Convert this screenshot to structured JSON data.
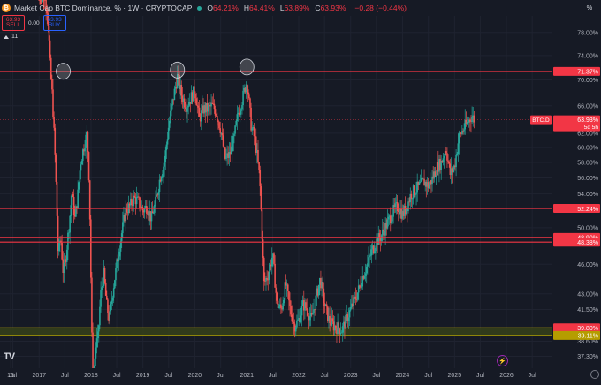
{
  "header": {
    "title": "Market Cap BTC Dominance, % · 1W · CRYPTOCAP",
    "logo_glyph": "₿",
    "ohlc": [
      {
        "key": "O",
        "value": "64.21%"
      },
      {
        "key": "H",
        "value": "64.41%"
      },
      {
        "key": "L",
        "value": "63.89%"
      },
      {
        "key": "C",
        "value": "63.93%"
      }
    ],
    "change": "−0.28 (−0.44%)",
    "sell_price": "63.93",
    "sell_label": "SELL",
    "spread": "0.00",
    "buy_price": "63.93",
    "buy_label": "BUY",
    "indicators_count": "11",
    "scale_button": "%"
  },
  "footer": {
    "tv_logo": "TV",
    "bolt_glyph": "⚡"
  },
  "colors": {
    "background": "#161a25",
    "up": "#26a69a",
    "down": "#ef5350",
    "level_line": "#f23645",
    "band_fill": "#36421a",
    "band_border": "#c8b400",
    "axis_text": "#b2b5be",
    "grid": "#1f2330"
  },
  "chart_data": {
    "type": "candlestick",
    "title": "Market Cap BTC Dominance, % · 1W · CRYPTOCAP",
    "xlabel": "",
    "ylabel": "",
    "y_scale": "log",
    "ylim": [
      36.3,
      81.0
    ],
    "x_range": [
      "2016-04-01",
      "2026-11-20"
    ],
    "x_ticks": [
      {
        "label": "16",
        "date": "2016-06-15"
      },
      {
        "label": "Jul",
        "date": "2016-07-01"
      },
      {
        "label": "2017",
        "date": "2017-01-01"
      },
      {
        "label": "Jul",
        "date": "2017-07-01"
      },
      {
        "label": "2018",
        "date": "2018-01-01"
      },
      {
        "label": "Jul",
        "date": "2018-07-01"
      },
      {
        "label": "2019",
        "date": "2019-01-01"
      },
      {
        "label": "Jul",
        "date": "2019-07-01"
      },
      {
        "label": "2020",
        "date": "2020-01-01"
      },
      {
        "label": "Jul",
        "date": "2020-07-01"
      },
      {
        "label": "2021",
        "date": "2021-01-01"
      },
      {
        "label": "Jul",
        "date": "2021-07-01"
      },
      {
        "label": "2022",
        "date": "2022-01-01"
      },
      {
        "label": "Jul",
        "date": "2022-07-01"
      },
      {
        "label": "2023",
        "date": "2023-01-01"
      },
      {
        "label": "Jul",
        "date": "2023-07-01"
      },
      {
        "label": "2024",
        "date": "2024-01-01"
      },
      {
        "label": "Jul",
        "date": "2024-07-01"
      },
      {
        "label": "2025",
        "date": "2025-01-01"
      },
      {
        "label": "Jul",
        "date": "2025-07-01"
      },
      {
        "label": "2026",
        "date": "2026-01-01"
      },
      {
        "label": "Jul",
        "date": "2026-07-01"
      }
    ],
    "y_ticks": [
      {
        "label": "78.00%",
        "value": 78.0
      },
      {
        "label": "74.00%",
        "value": 74.0
      },
      {
        "label": "70.00%",
        "value": 70.0
      },
      {
        "label": "66.00%",
        "value": 66.0
      },
      {
        "label": "62.00%",
        "value": 62.0
      },
      {
        "label": "60.00%",
        "value": 60.0
      },
      {
        "label": "58.00%",
        "value": 58.0
      },
      {
        "label": "56.00%",
        "value": 56.0
      },
      {
        "label": "54.00%",
        "value": 54.0
      },
      {
        "label": "50.00%",
        "value": 50.0
      },
      {
        "label": "46.00%",
        "value": 46.0
      },
      {
        "label": "43.00%",
        "value": 43.0
      },
      {
        "label": "41.50%",
        "value": 41.5
      },
      {
        "label": "38.60%",
        "value": 38.6
      },
      {
        "label": "37.30%",
        "value": 37.3
      }
    ],
    "horizontal_levels": [
      {
        "label": "71.37%",
        "value": 71.37
      },
      {
        "label": "52.24%",
        "value": 52.24
      },
      {
        "label": "48.90%",
        "value": 48.9
      },
      {
        "label": "48.38%",
        "value": 48.38
      }
    ],
    "support_band": {
      "upper_label": "39.80%",
      "upper": 39.8,
      "lower_label": "39.11%",
      "lower": 39.11
    },
    "current_price": {
      "symbol": "BTC.D",
      "value": 63.93,
      "label": "63.93%",
      "countdown": "5d 5h"
    },
    "highlighted_highs": [
      {
        "date": "2017-06-20",
        "value": 71.4
      },
      {
        "date": "2019-09-01",
        "value": 71.6
      },
      {
        "date": "2021-01-01",
        "value": 72.1
      }
    ],
    "price_path": [
      [
        "2017-01-01",
        87.0
      ],
      [
        "2017-02-01",
        85.5
      ],
      [
        "2017-03-01",
        82.0
      ],
      [
        "2017-03-20",
        72.0
      ],
      [
        "2017-04-05",
        67.0
      ],
      [
        "2017-04-25",
        58.0
      ],
      [
        "2017-05-15",
        47.0
      ],
      [
        "2017-06-01",
        49.0
      ],
      [
        "2017-06-20",
        45.0
      ],
      [
        "2017-07-10",
        47.0
      ],
      [
        "2017-08-01",
        50.5
      ],
      [
        "2017-08-20",
        54.0
      ],
      [
        "2017-09-10",
        51.0
      ],
      [
        "2017-10-01",
        54.0
      ],
      [
        "2017-10-20",
        58.0
      ],
      [
        "2017-11-15",
        60.5
      ],
      [
        "2017-12-05",
        62.0
      ],
      [
        "2017-12-20",
        55.0
      ],
      [
        "2018-01-05",
        40.0
      ],
      [
        "2018-01-15",
        34.5
      ],
      [
        "2018-02-01",
        38.0
      ],
      [
        "2018-02-20",
        39.0
      ],
      [
        "2018-03-10",
        43.0
      ],
      [
        "2018-04-01",
        45.0
      ],
      [
        "2018-04-20",
        42.0
      ],
      [
        "2018-05-10",
        40.5
      ],
      [
        "2018-06-01",
        43.0
      ],
      [
        "2018-07-01",
        46.0
      ],
      [
        "2018-08-01",
        49.0
      ],
      [
        "2018-09-01",
        52.0
      ],
      [
        "2018-10-01",
        52.5
      ],
      [
        "2018-11-01",
        53.5
      ],
      [
        "2018-12-01",
        53.0
      ],
      [
        "2019-01-01",
        52.0
      ],
      [
        "2019-02-01",
        52.5
      ],
      [
        "2019-03-01",
        51.0
      ],
      [
        "2019-04-01",
        53.0
      ],
      [
        "2019-05-01",
        56.0
      ],
      [
        "2019-06-01",
        58.0
      ],
      [
        "2019-07-01",
        63.0
      ],
      [
        "2019-08-01",
        67.0
      ],
      [
        "2019-09-01",
        70.5
      ],
      [
        "2019-10-01",
        67.5
      ],
      [
        "2019-11-01",
        66.0
      ],
      [
        "2019-12-01",
        67.0
      ],
      [
        "2020-01-01",
        68.5
      ],
      [
        "2020-02-01",
        64.0
      ],
      [
        "2020-03-01",
        65.5
      ],
      [
        "2020-04-01",
        65.5
      ],
      [
        "2020-05-01",
        66.0
      ],
      [
        "2020-06-01",
        65.0
      ],
      [
        "2020-07-01",
        62.5
      ],
      [
        "2020-08-01",
        58.5
      ],
      [
        "2020-09-01",
        59.0
      ],
      [
        "2020-10-01",
        61.0
      ],
      [
        "2020-11-01",
        65.0
      ],
      [
        "2020-12-01",
        67.0
      ],
      [
        "2021-01-01",
        70.0
      ],
      [
        "2021-02-01",
        63.0
      ],
      [
        "2021-03-01",
        61.0
      ],
      [
        "2021-04-01",
        56.0
      ],
      [
        "2021-05-01",
        44.0
      ],
      [
        "2021-06-01",
        45.0
      ],
      [
        "2021-07-01",
        47.0
      ],
      [
        "2021-08-01",
        42.0
      ],
      [
        "2021-09-01",
        41.5
      ],
      [
        "2021-10-01",
        44.0
      ],
      [
        "2021-11-01",
        41.5
      ],
      [
        "2021-12-01",
        40.0
      ],
      [
        "2022-01-01",
        40.5
      ],
      [
        "2022-02-01",
        42.0
      ],
      [
        "2022-03-01",
        41.5
      ],
      [
        "2022-04-01",
        40.5
      ],
      [
        "2022-05-01",
        42.5
      ],
      [
        "2022-06-01",
        44.5
      ],
      [
        "2022-07-01",
        42.0
      ],
      [
        "2022-08-01",
        40.5
      ],
      [
        "2022-09-01",
        40.0
      ],
      [
        "2022-10-01",
        39.8
      ],
      [
        "2022-11-01",
        39.6
      ],
      [
        "2022-12-01",
        40.5
      ],
      [
        "2023-01-01",
        41.5
      ],
      [
        "2023-02-01",
        42.5
      ],
      [
        "2023-03-01",
        43.5
      ],
      [
        "2023-04-01",
        45.0
      ],
      [
        "2023-05-01",
        46.0
      ],
      [
        "2023-06-01",
        47.5
      ],
      [
        "2023-07-01",
        48.5
      ],
      [
        "2023-08-01",
        49.0
      ],
      [
        "2023-09-01",
        50.0
      ],
      [
        "2023-10-01",
        51.0
      ],
      [
        "2023-11-01",
        52.0
      ],
      [
        "2023-12-01",
        52.5
      ],
      [
        "2024-01-01",
        51.5
      ],
      [
        "2024-02-01",
        52.5
      ],
      [
        "2024-03-01",
        54.0
      ],
      [
        "2024-04-01",
        54.5
      ],
      [
        "2024-05-01",
        55.0
      ],
      [
        "2024-06-01",
        55.5
      ],
      [
        "2024-07-01",
        55.0
      ],
      [
        "2024-08-01",
        56.0
      ],
      [
        "2024-09-01",
        57.5
      ],
      [
        "2024-10-01",
        58.0
      ],
      [
        "2024-11-01",
        60.0
      ],
      [
        "2024-12-01",
        56.5
      ],
      [
        "2025-01-01",
        57.5
      ],
      [
        "2025-02-01",
        61.5
      ],
      [
        "2025-03-01",
        62.5
      ],
      [
        "2025-04-01",
        63.5
      ],
      [
        "2025-05-01",
        64.5
      ],
      [
        "2025-05-20",
        63.93
      ]
    ]
  }
}
